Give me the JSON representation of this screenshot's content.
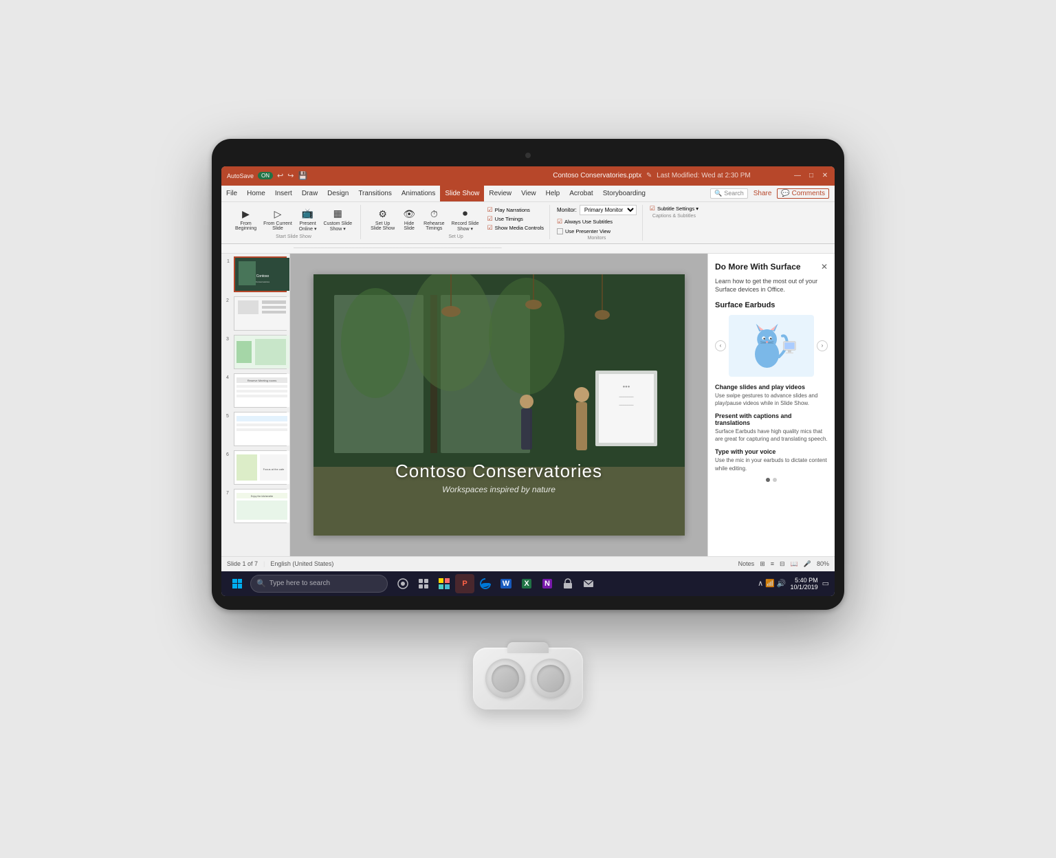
{
  "device": {
    "type": "Surface tablet"
  },
  "titlebar": {
    "autosave_label": "AutoSave",
    "autosave_state": "ON",
    "filename": "Contoso Conservatories.pptx",
    "last_modified": "Last Modified: Wed at 2:30 PM",
    "minimize": "—",
    "restore": "□",
    "close": "✕"
  },
  "menubar": {
    "items": [
      "File",
      "Home",
      "Insert",
      "Draw",
      "Design",
      "Transitions",
      "Animations",
      "Slide Show",
      "Review",
      "View",
      "Help",
      "Acrobat",
      "Storyboarding"
    ],
    "active_item": "Slide Show",
    "search_placeholder": "Search",
    "share_label": "Share",
    "comments_label": "Comments"
  },
  "ribbon": {
    "groups": [
      {
        "name": "Start Slide Show",
        "items": [
          {
            "icon": "▶",
            "label": "From Beginning"
          },
          {
            "icon": "▷",
            "label": "From Current Slide"
          },
          {
            "icon": "📺",
            "label": "Present Online"
          },
          {
            "icon": "▦",
            "label": "Custom Slide Show ▾"
          }
        ]
      },
      {
        "name": "Set Up",
        "items": [
          {
            "icon": "⚙",
            "label": "Set Up Slide Show"
          },
          {
            "icon": "👁",
            "label": "Hide Slide"
          },
          {
            "icon": "⏱",
            "label": "Rehearse Timings"
          },
          {
            "icon": "⏺",
            "label": "Record Slide Show ▾"
          }
        ],
        "checkboxes": [
          "Play Narrations",
          "Use Timings",
          "Show Media Controls"
        ]
      },
      {
        "name": "Monitors",
        "monitor_label": "Monitor:",
        "monitor_value": "Primary Monitor",
        "checkboxes": [
          "Always Use Subtitles",
          "Use Presenter View"
        ]
      },
      {
        "name": "Captions & Subtitles",
        "checkboxes": [
          "Subtitle Settings ▾"
        ]
      }
    ]
  },
  "slides": [
    {
      "num": 1,
      "active": true,
      "thumb_class": "slide-thumb-1"
    },
    {
      "num": 2,
      "active": false,
      "thumb_class": "slide-thumb-2"
    },
    {
      "num": 3,
      "active": false,
      "thumb_class": "slide-thumb-3"
    },
    {
      "num": 4,
      "active": false,
      "thumb_class": "slide-thumb-4"
    },
    {
      "num": 5,
      "active": false,
      "thumb_class": "slide-thumb-5"
    },
    {
      "num": 6,
      "active": false,
      "thumb_class": "slide-thumb-6"
    },
    {
      "num": 7,
      "active": false,
      "thumb_class": "slide-thumb-7"
    }
  ],
  "main_slide": {
    "title": "Contoso Conservatories",
    "subtitle": "Workspaces inspired by nature"
  },
  "side_panel": {
    "title": "Do More With Surface",
    "description": "Learn how to get the most out of your Surface devices in Office.",
    "section_title": "Surface Earbuds",
    "carousel_prev": "‹",
    "carousel_next": "›",
    "features": [
      {
        "title": "Change slides and play videos",
        "description": "Use swipe gestures to advance slides and play/pause videos while in Slide Show."
      },
      {
        "title": "Present with captions and translations",
        "description": "Surface Earbuds have high quality mics that are great for capturing and translating speech."
      },
      {
        "title": "Type with your voice",
        "description": "Use the mic in your earbuds to dictate content while editing."
      }
    ],
    "dots": [
      {
        "active": true
      },
      {
        "active": false
      }
    ],
    "close_btn": "✕"
  },
  "statusbar": {
    "slide_info": "Slide 1 of 7",
    "language": "English (United States)",
    "notes_label": "Notes",
    "zoom": "80%"
  },
  "taskbar": {
    "search_placeholder": "Type here to search",
    "apps": [
      "🪟",
      "🔍",
      "🖥",
      "📁",
      "📊",
      "🌐",
      "W",
      "X",
      "📓",
      "🛍",
      "✉"
    ],
    "time": "5:40 PM",
    "date": "10/1/2019"
  },
  "colors": {
    "ppt_accent": "#b7472a",
    "ribbon_bg": "#f3f3f3",
    "taskbar_bg": "#1a1a2e",
    "slide_panel_bg": "#f0f0f0"
  }
}
